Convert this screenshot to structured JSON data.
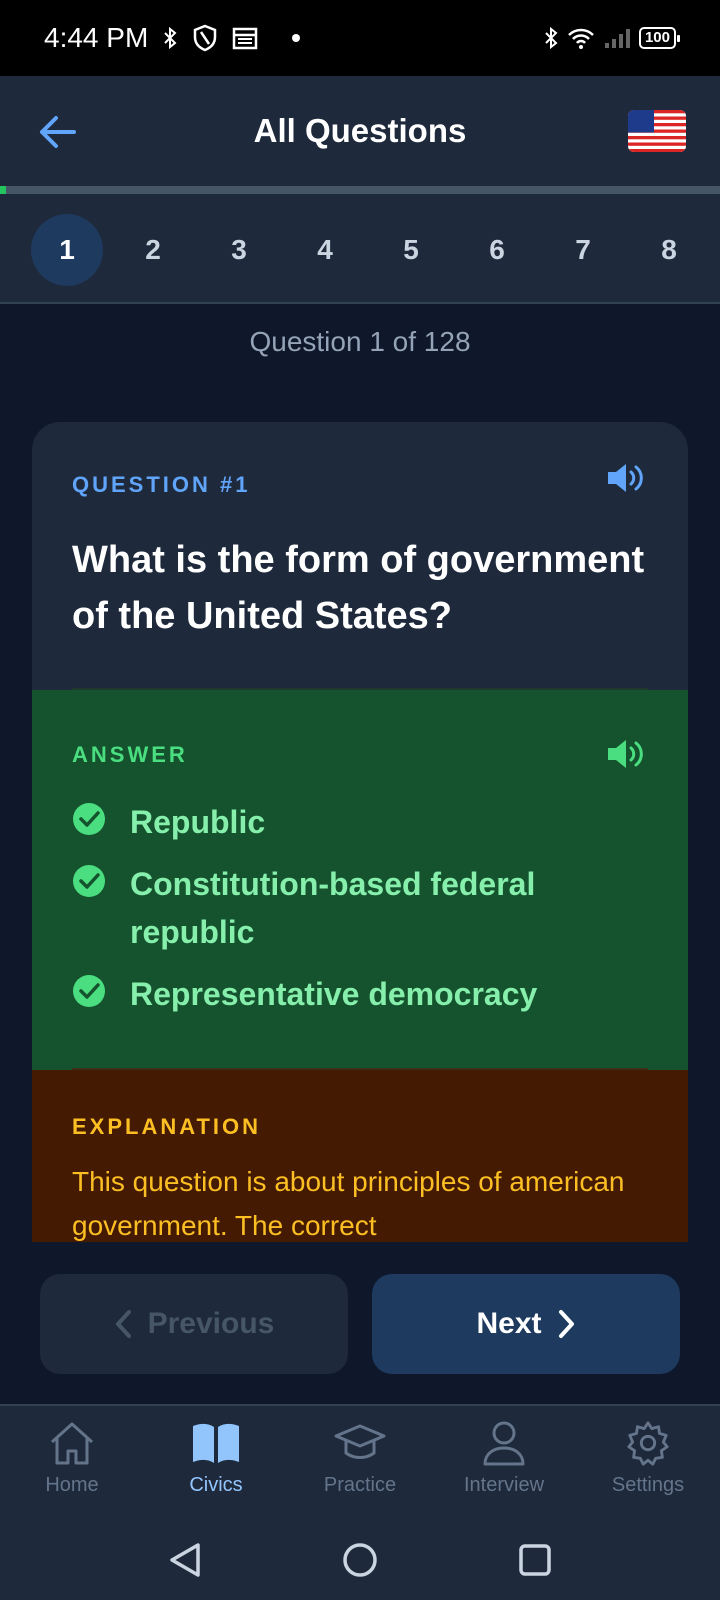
{
  "status_bar": {
    "time": "4:44 PM",
    "battery": "100"
  },
  "header": {
    "title": "All Questions"
  },
  "progress": {
    "fraction": 0.0078
  },
  "question_nav": {
    "numbers": [
      "1",
      "2",
      "3",
      "4",
      "5",
      "6",
      "7",
      "8"
    ],
    "active": "1"
  },
  "counter": "Question 1 of 128",
  "question": {
    "label": "QUESTION #1",
    "text": "What is the form of government of the United States?"
  },
  "answer": {
    "label": "ANSWER",
    "items": [
      "Republic",
      "Constitution-based federal republic",
      "Representative democracy"
    ]
  },
  "explanation": {
    "label": "EXPLANATION",
    "text": "This question is about principles of american government. The correct"
  },
  "buttons": {
    "previous": "Previous",
    "next": "Next"
  },
  "tabs": [
    {
      "label": "Home",
      "icon": "home-icon"
    },
    {
      "label": "Civics",
      "icon": "book-icon"
    },
    {
      "label": "Practice",
      "icon": "graduation-cap-icon"
    },
    {
      "label": "Interview",
      "icon": "person-icon"
    },
    {
      "label": "Settings",
      "icon": "gear-icon"
    }
  ],
  "colors": {
    "accent_blue": "#60a5fa",
    "answer_green": "#4ade80",
    "explanation_amber": "#fbbf24"
  }
}
